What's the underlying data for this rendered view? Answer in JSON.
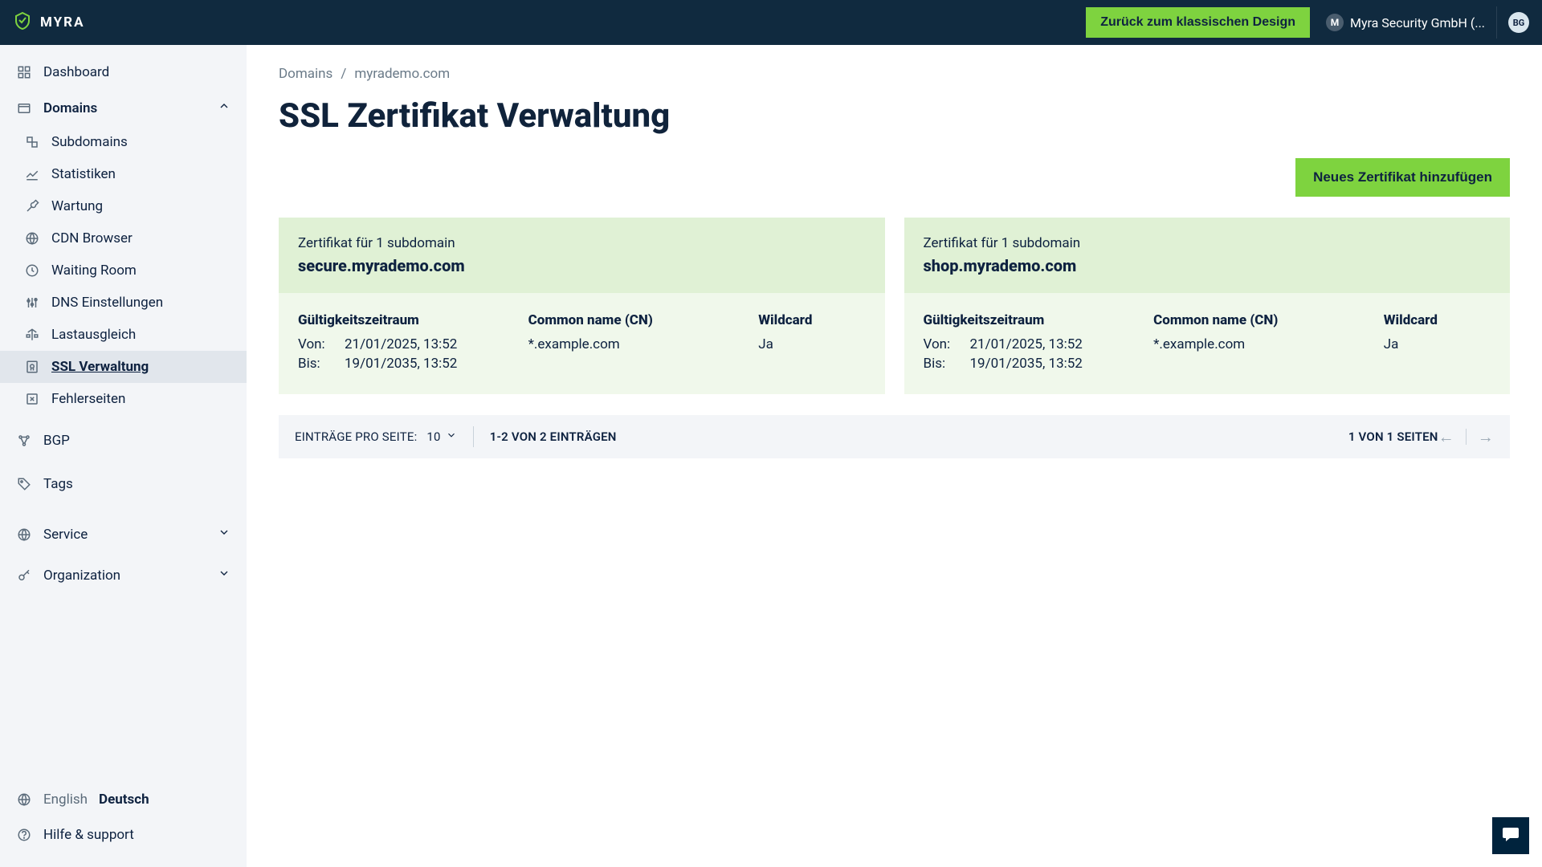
{
  "brand": "MYRA",
  "header": {
    "classic_btn": "Zurück zum klassischen Design",
    "org_name": "Myra Security GmbH (...",
    "org_badge": "M",
    "avatar": "BG"
  },
  "sidebar": {
    "dashboard": "Dashboard",
    "domains": "Domains",
    "sub": {
      "subdomains": "Subdomains",
      "stats": "Statistiken",
      "wartung": "Wartung",
      "cdn": "CDN Browser",
      "waiting": "Waiting Room",
      "dns": "DNS Einstellungen",
      "lastaus": "Lastausgleich",
      "ssl": "SSL Verwaltung",
      "fehler": "Fehlerseiten"
    },
    "bgp": "BGP",
    "tags": "Tags",
    "service": "Service",
    "organization": "Organization",
    "lang_en": "English",
    "lang_de": "Deutsch",
    "help": "Hilfe & support"
  },
  "breadcrumb": {
    "root": "Domains",
    "current": "myrademo.com"
  },
  "page_title": "SSL Zertifikat Verwaltung",
  "add_btn": "Neues Zertifikat hinzufügen",
  "labels": {
    "validity": "Gültigkeitszeitraum",
    "cn": "Common name (CN)",
    "wildcard": "Wildcard",
    "from": "Von:",
    "to": "Bis:"
  },
  "certificates": [
    {
      "subtitle": "Zertifikat für 1 subdomain",
      "domain": "secure.myrademo.com",
      "from": "21/01/2025, 13:52",
      "to": "19/01/2035, 13:52",
      "cn": "*.example.com",
      "wildcard": "Ja"
    },
    {
      "subtitle": "Zertifikat für 1 subdomain",
      "domain": "shop.myrademo.com",
      "from": "21/01/2025, 13:52",
      "to": "19/01/2035, 13:52",
      "cn": "*.example.com",
      "wildcard": "Ja"
    }
  ],
  "pager": {
    "per_page_label": "EINTRÄGE PRO SEITE:",
    "per_page_value": "10",
    "count": "1-2 VON 2 EINTRÄGEN",
    "pages": "1 VON 1 SEITEN"
  }
}
